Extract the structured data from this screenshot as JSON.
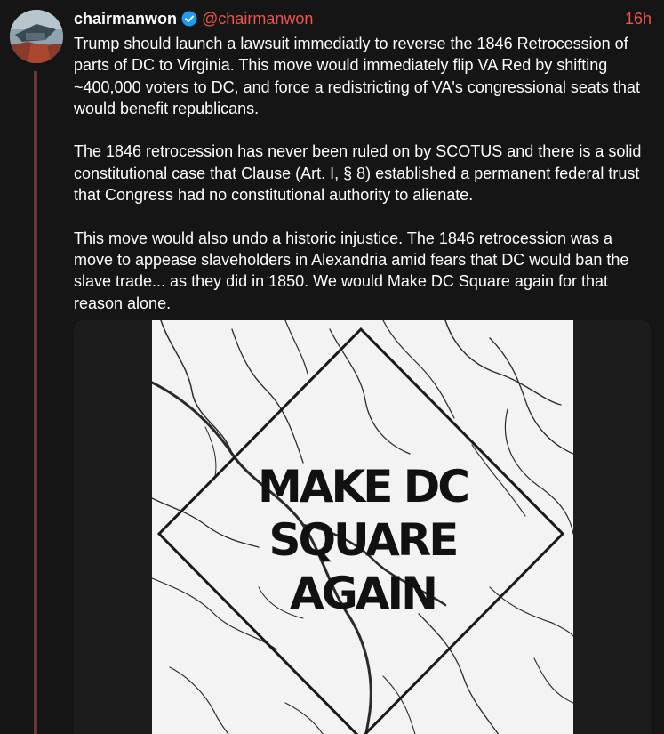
{
  "post": {
    "author": {
      "display_name": "chairmanwon",
      "handle": "@chairmanwon",
      "verified": true,
      "avatar_icon": "profile-avatar"
    },
    "timestamp": "16h",
    "paragraphs": [
      "Trump should launch a lawsuit immediatly to reverse the 1846 Retrocession of parts of DC to Virginia. This move would immediately flip VA Red by shifting ~400,000 voters to DC, and force a redistricting of VA's congressional seats that would benefit republicans.",
      "The 1846 retrocession has never been ruled on by SCOTUS and there is a solid constitutional case that Clause (Art. I, § 8) established a permanent federal trust that Congress had no constitutional authority to alienate.",
      "This move would also undo a historic injustice. The 1846 retrocession was a move to appease slaveholders in Alexandria amid fears that DC would ban the slave trade... as they did in 1850. We would Make DC Square again for that reason alone."
    ],
    "media": {
      "poster_lines": [
        "MAKE DC",
        "SQUARE",
        "AGAIN"
      ]
    }
  },
  "colors": {
    "background": "#151515",
    "text": "#ffffff",
    "accent": "#ef5350",
    "thread_line": "#6e3737",
    "verified": "#1d9bf0"
  }
}
